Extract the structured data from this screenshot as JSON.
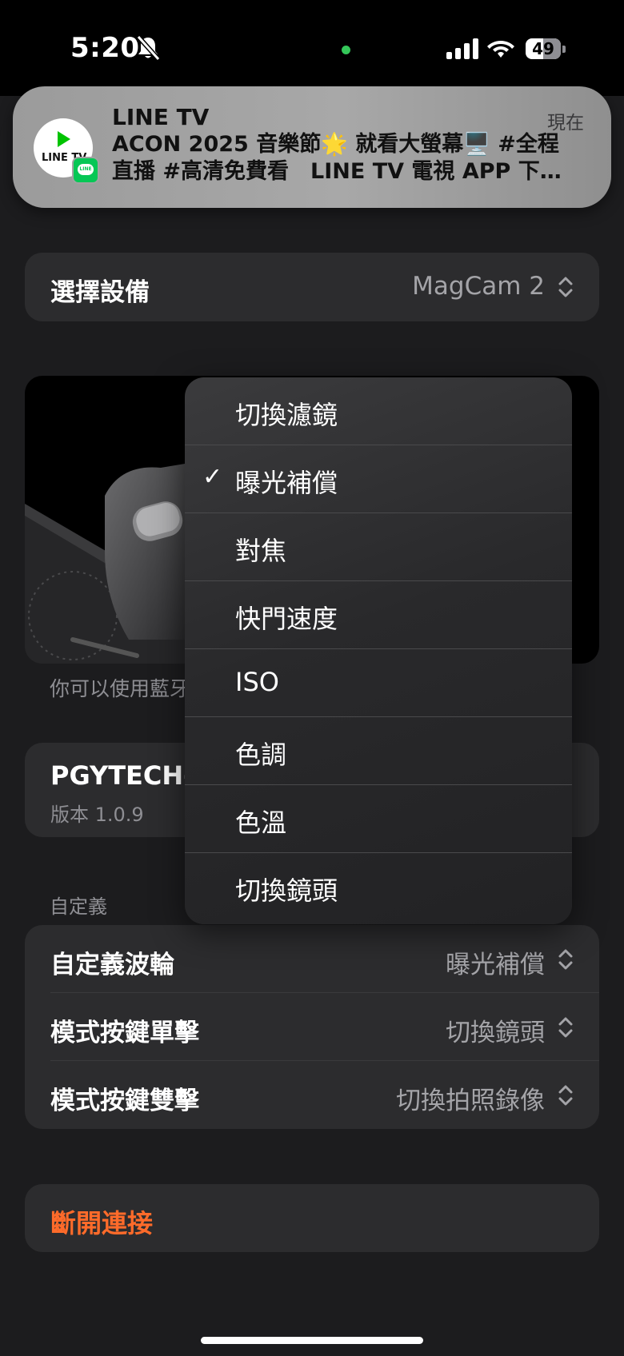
{
  "status_bar": {
    "time": "5:20",
    "battery": "49"
  },
  "notification": {
    "app_name": "LINE TV",
    "time": "現在",
    "icon_text": "LINE TV",
    "badge_text": "LINE",
    "body": "ACON 2025 音樂節🌟 就看大螢幕🖥️ #全程直播 #高清免費看　LINE TV 電視 APP 下…"
  },
  "device_select": {
    "label": "選擇設備",
    "value": "MagCam 2"
  },
  "preview": {
    "caption": "你可以使用藍牙"
  },
  "device_info": {
    "name": "PGYTECH-",
    "version": "版本 1.0.9"
  },
  "custom_section": {
    "header": "自定義",
    "rows": [
      {
        "label": "自定義波輪",
        "value": "曝光補償"
      },
      {
        "label": "模式按鍵單擊",
        "value": "切換鏡頭"
      },
      {
        "label": "模式按鍵雙擊",
        "value": "切換拍照錄像"
      }
    ]
  },
  "disconnect": {
    "label": "斷開連接"
  },
  "menu": {
    "items": [
      {
        "label": "切換濾鏡",
        "checked": false
      },
      {
        "label": "曝光補償",
        "checked": true
      },
      {
        "label": "對焦",
        "checked": false
      },
      {
        "label": "快門速度",
        "checked": false
      },
      {
        "label": "ISO",
        "checked": false
      },
      {
        "label": "色調",
        "checked": false
      },
      {
        "label": "色溫",
        "checked": false
      },
      {
        "label": "切換鏡頭",
        "checked": false
      }
    ],
    "check_glyph": "✓"
  },
  "colors": {
    "accent_orange": "#ff6b2a",
    "background": "#1c1c1e",
    "card": "#2c2c2e"
  }
}
